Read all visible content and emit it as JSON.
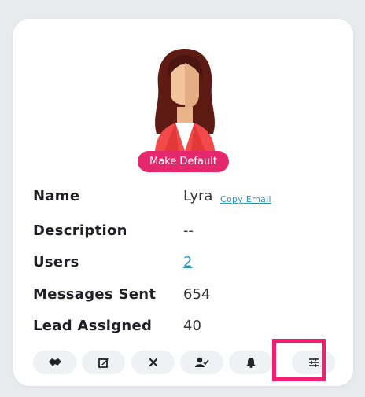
{
  "profile": {
    "make_default_label": "Make Default",
    "copy_email_label": "Copy Email"
  },
  "details": {
    "name_label": "Name",
    "name_value": "Lyra",
    "description_label": "Description",
    "description_value": "--",
    "users_label": "Users",
    "users_value": "2",
    "messages_label": "Messages Sent",
    "messages_value": "654",
    "lead_label": "Lead Assigned",
    "lead_value": "40"
  },
  "actions": [
    {
      "icon": "handshake-icon"
    },
    {
      "icon": "edit-icon"
    },
    {
      "icon": "close-icon"
    },
    {
      "icon": "user-check-icon"
    },
    {
      "icon": "bell-icon"
    },
    {
      "icon": "sliders-icon"
    }
  ],
  "colors": {
    "accent": "#e5286e",
    "link": "#2a97c7",
    "highlight": "#f21e6f"
  }
}
